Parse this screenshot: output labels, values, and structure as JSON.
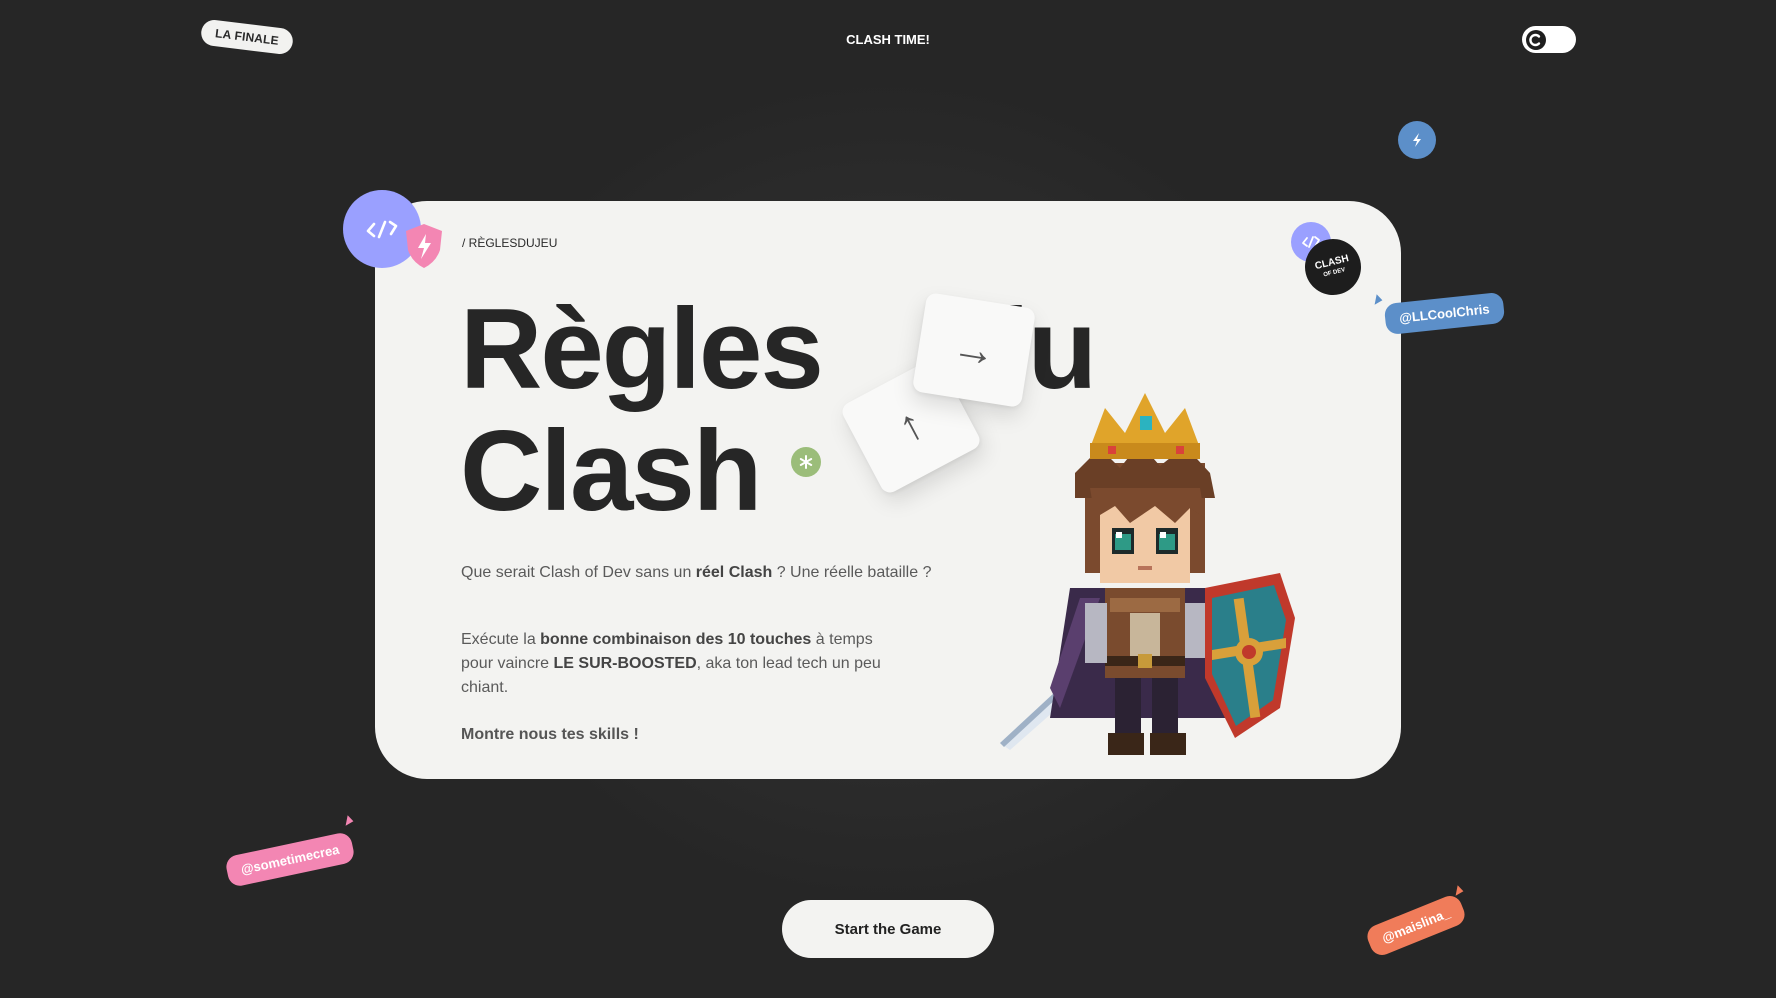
{
  "header": {
    "tag_left": "LA FINALE",
    "title": "CLASH TIME!",
    "theme_toggle_icon": "theme-toggle-icon"
  },
  "card": {
    "breadcrumb": "/ RÈGLESDUJEU",
    "title_line1_word1": "Règles",
    "title_line1_word2": "du",
    "title_line2": "Clash",
    "intro_before": "Que serait Clash of Dev sans un ",
    "intro_bold": "réel Clash",
    "intro_after": " ? Une réelle bataille ?",
    "rules_part1": "Exécute la ",
    "rules_bold1": "bonne combinaison des 10 touches",
    "rules_part2": " à temps pour vaincre ",
    "rules_bold2": "LE SUR-BOOSTED",
    "rules_part3": ", aka ton lead tech un peu chiant.",
    "cta_text": "Montre nous tes skills !",
    "logo_text_line1": "CLASH",
    "logo_text_line2": "OF DEV",
    "key_up": "↑",
    "key_right": "→"
  },
  "floating_tags": {
    "chris": "@LLCoolChris",
    "sometime": "@sometimecrea",
    "mai": "@maislina_"
  },
  "actions": {
    "start_label": "Start the Game"
  },
  "colors": {
    "background": "#262626",
    "card": "#f3f3f1",
    "purple": "#9aa0ff",
    "pink": "#f386b3",
    "blue": "#5c8fc9",
    "orange": "#f07c5a",
    "green": "#9bbd7a"
  }
}
